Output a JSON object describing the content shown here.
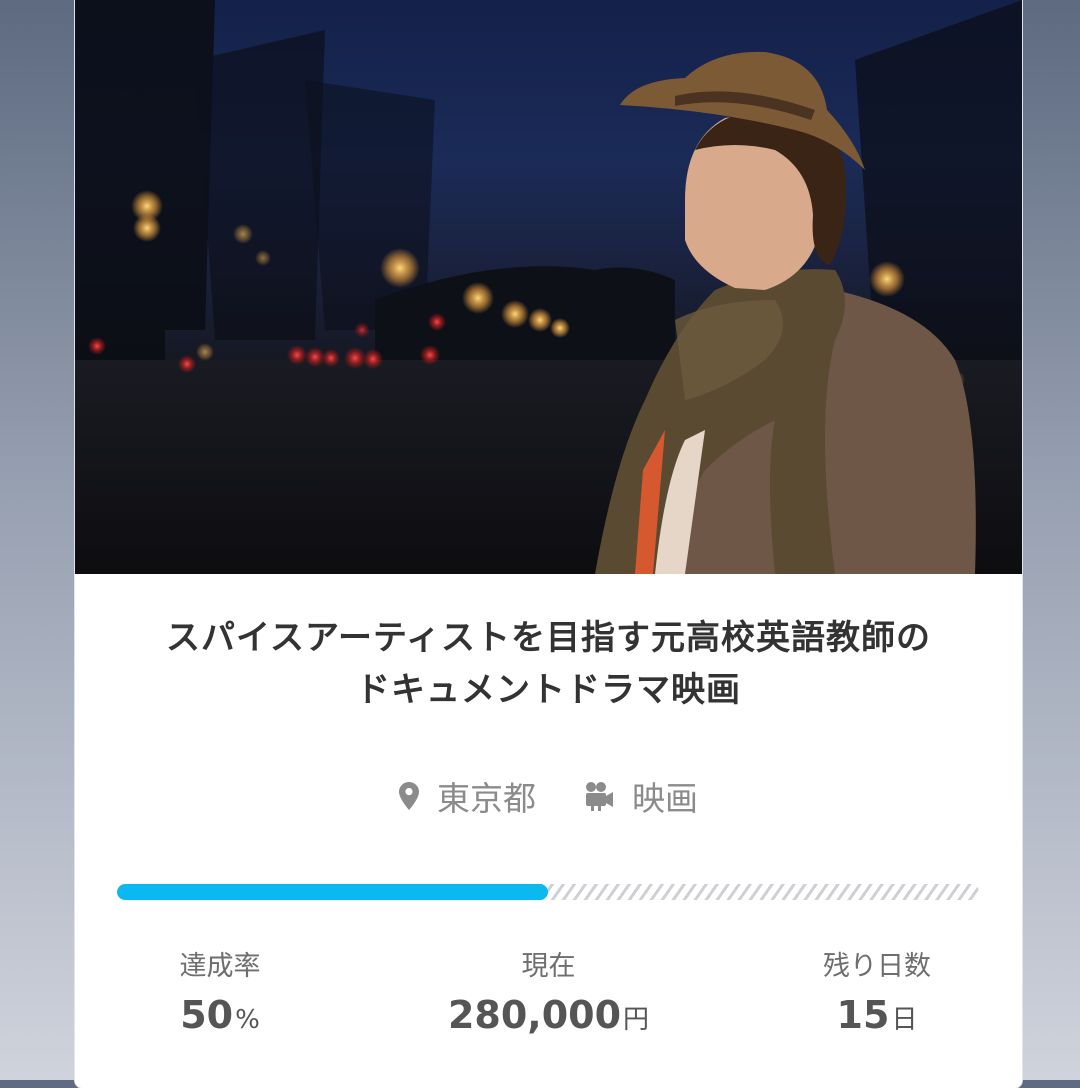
{
  "project": {
    "title_line1": "スパイスアーティストを目指す元高校英語教師の",
    "title_line2": "ドキュメントドラマ映画",
    "location": "東京都",
    "category": "映画"
  },
  "progress": {
    "percent_funded": 50
  },
  "stats": {
    "rate_label": "達成率",
    "rate_value": "50",
    "rate_unit": "%",
    "current_label": "現在",
    "current_value": "280,000",
    "current_unit": "円",
    "days_label": "残り日数",
    "days_value": "15",
    "days_unit": "日"
  },
  "icons": {
    "location": "map-pin-icon",
    "category": "video-camera-icon"
  },
  "colors": {
    "progress_fill": "#0ab9ef",
    "title_text": "#333333",
    "meta_text": "#8b8b8b"
  }
}
